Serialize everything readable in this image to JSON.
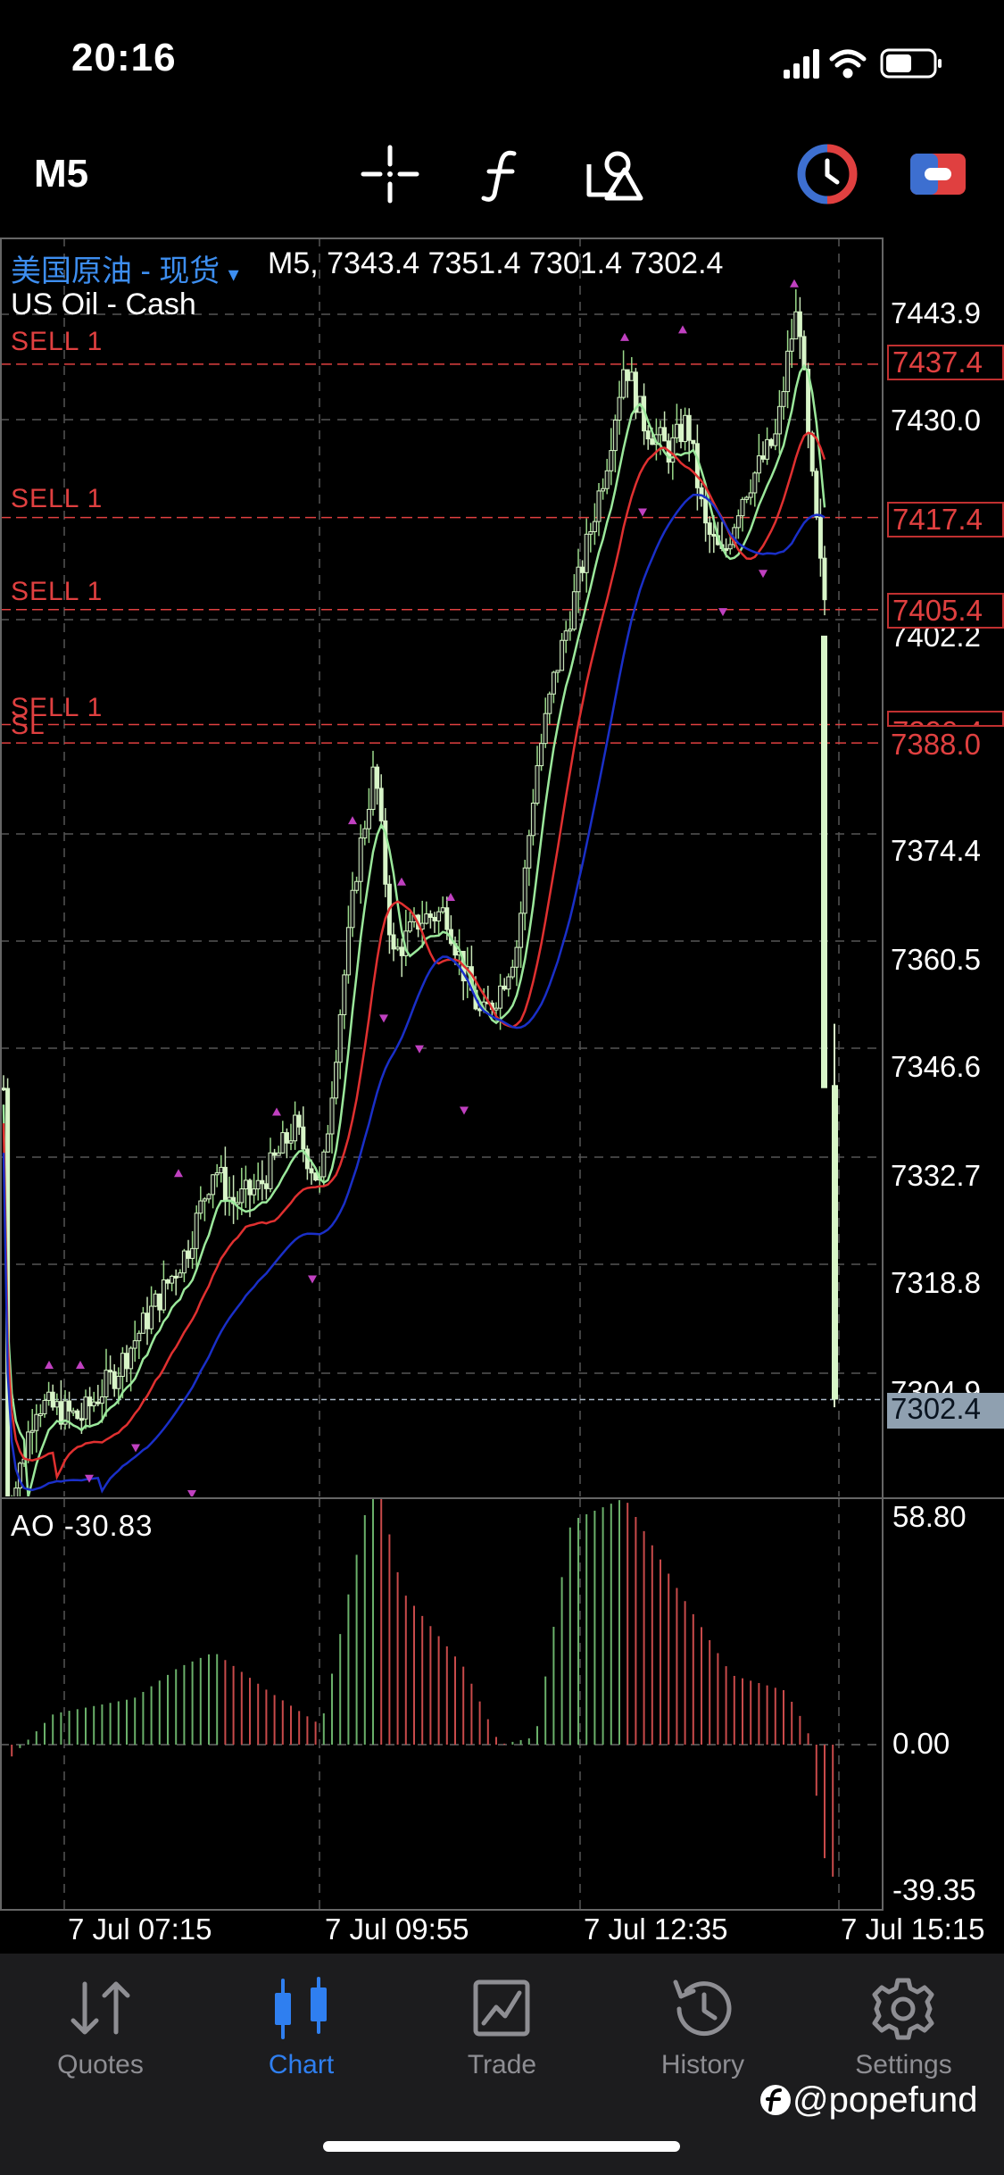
{
  "status_bar": {
    "time": "20:16"
  },
  "toolbar": {
    "timeframe": "M5",
    "icons": [
      "crosshair-icon",
      "function-icon",
      "objects-icon",
      "indicator-icon",
      "account-icon"
    ]
  },
  "chart": {
    "symbol_cn": "美国原油 - 现货",
    "ohlc_text": "M5, 7343.4 7351.4 7301.4 7302.4",
    "symbol_en": "US Oil - Cash",
    "orders": [
      {
        "label": "SELL 1",
        "price": 7437.4
      },
      {
        "label": "SELL 1",
        "price": 7417.4
      },
      {
        "label": "SELL 1",
        "price": 7405.4
      },
      {
        "label": "SELL 1",
        "price": 7390.4
      },
      {
        "label": "SL",
        "price": 7388.0
      }
    ],
    "price_ticks": [
      "7443.9",
      "7430.0",
      "7402.2",
      "7374.4",
      "7360.5",
      "7346.6",
      "7332.7",
      "7318.8",
      "7304.9"
    ],
    "price_tags": [
      "7437.4",
      "7417.4",
      "7405.4",
      "7390.4",
      "7388.0"
    ],
    "current_price": "7302.4",
    "time_ticks": [
      "7 Jul 07:15",
      "7 Jul 09:55",
      "7 Jul 12:35",
      "7 Jul 15:15"
    ],
    "colors": {
      "bull": "#d8f5c8",
      "ma_fast": "#9be89b",
      "ma_mid": "#e03030",
      "ma_slow": "#1a2fc8",
      "order": "#e04040",
      "arrow": "#c040c0"
    }
  },
  "ao": {
    "label": "AO -30.83",
    "ticks": [
      "58.80",
      "0.00",
      "-39.35"
    ]
  },
  "tabs": [
    {
      "label": "Quotes",
      "icon": "quotes-icon",
      "active": false
    },
    {
      "label": "Chart",
      "icon": "chart-icon",
      "active": true
    },
    {
      "label": "Trade",
      "icon": "trade-icon",
      "active": false
    },
    {
      "label": "History",
      "icon": "history-icon",
      "active": false
    },
    {
      "label": "Settings",
      "icon": "gear-icon",
      "active": false
    }
  ],
  "watermark": "@popefund"
}
